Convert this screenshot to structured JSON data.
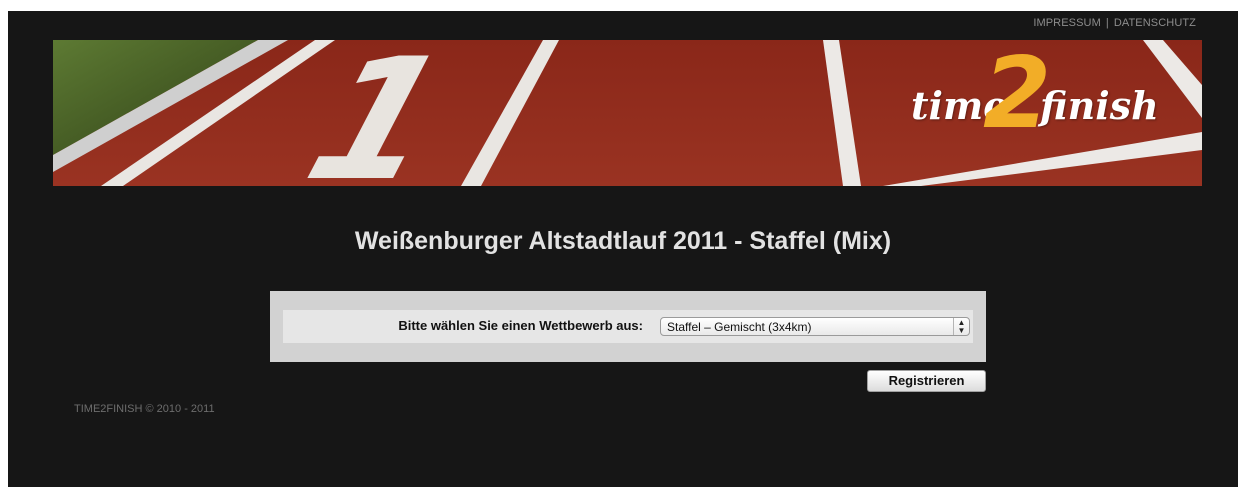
{
  "header": {
    "links": [
      "IMPRESSUM",
      "DATENSCHUTZ"
    ],
    "separator": "|"
  },
  "banner": {
    "logo_left": "time",
    "logo_number": "2",
    "logo_right": "finish",
    "lane_number": "1"
  },
  "main": {
    "title": "Weißenburger Altstadtlauf 2011 - Staffel (Mix)",
    "form": {
      "label": "Bitte wählen Sie einen Wettbewerb aus:",
      "selected_value": "Staffel – Gemischt (3x4km)"
    },
    "register_label": "Registrieren"
  },
  "footer": {
    "copyright": "TIME2FINISH © 2010 - 2011"
  },
  "colors": {
    "page_bg": "#161616",
    "track_red": "#8e2a1d",
    "logo_accent": "#f2ad27",
    "title_text": "#e2e2e2"
  }
}
